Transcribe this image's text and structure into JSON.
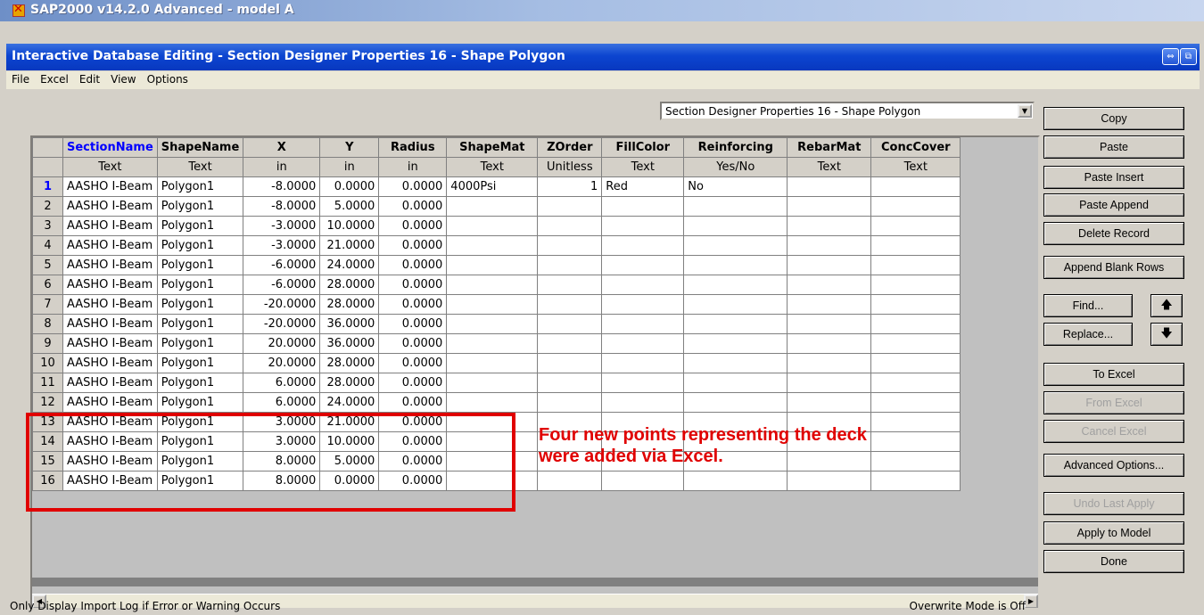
{
  "app": {
    "title": "SAP2000 v14.2.0 Advanced  - model A"
  },
  "window": {
    "title": "Interactive Database Editing - Section Designer Properties 16 - Shape Polygon",
    "restore_glyph": "⇔",
    "dock_glyph": "⧉"
  },
  "menu": [
    "File",
    "Excel",
    "Edit",
    "View",
    "Options"
  ],
  "table_selector": {
    "value": "Section Designer Properties 16 - Shape Polygon",
    "arrow": "▼"
  },
  "grid": {
    "columns": [
      "SectionName",
      "ShapeName",
      "X",
      "Y",
      "Radius",
      "ShapeMat",
      "ZOrder",
      "FillColor",
      "Reinforcing",
      "RebarMat",
      "ConcCover"
    ],
    "units": [
      "Text",
      "Text",
      "in",
      "in",
      "in",
      "Text",
      "Unitless",
      "Text",
      "Yes/No",
      "Text",
      "Text"
    ],
    "rows": [
      [
        "1",
        "AASHO I-Beam",
        "Polygon1",
        "-8.0000",
        "0.0000",
        "0.0000",
        "4000Psi",
        "1",
        "Red",
        "No",
        "",
        ""
      ],
      [
        "2",
        "AASHO I-Beam",
        "Polygon1",
        "-8.0000",
        "5.0000",
        "0.0000",
        "",
        "",
        "",
        "",
        "",
        ""
      ],
      [
        "3",
        "AASHO I-Beam",
        "Polygon1",
        "-3.0000",
        "10.0000",
        "0.0000",
        "",
        "",
        "",
        "",
        "",
        ""
      ],
      [
        "4",
        "AASHO I-Beam",
        "Polygon1",
        "-3.0000",
        "21.0000",
        "0.0000",
        "",
        "",
        "",
        "",
        "",
        ""
      ],
      [
        "5",
        "AASHO I-Beam",
        "Polygon1",
        "-6.0000",
        "24.0000",
        "0.0000",
        "",
        "",
        "",
        "",
        "",
        ""
      ],
      [
        "6",
        "AASHO I-Beam",
        "Polygon1",
        "-6.0000",
        "28.0000",
        "0.0000",
        "",
        "",
        "",
        "",
        "",
        ""
      ],
      [
        "7",
        "AASHO I-Beam",
        "Polygon1",
        "-20.0000",
        "28.0000",
        "0.0000",
        "",
        "",
        "",
        "",
        "",
        ""
      ],
      [
        "8",
        "AASHO I-Beam",
        "Polygon1",
        "-20.0000",
        "36.0000",
        "0.0000",
        "",
        "",
        "",
        "",
        "",
        ""
      ],
      [
        "9",
        "AASHO I-Beam",
        "Polygon1",
        "20.0000",
        "36.0000",
        "0.0000",
        "",
        "",
        "",
        "",
        "",
        ""
      ],
      [
        "10",
        "AASHO I-Beam",
        "Polygon1",
        "20.0000",
        "28.0000",
        "0.0000",
        "",
        "",
        "",
        "",
        "",
        ""
      ],
      [
        "11",
        "AASHO I-Beam",
        "Polygon1",
        "6.0000",
        "28.0000",
        "0.0000",
        "",
        "",
        "",
        "",
        "",
        ""
      ],
      [
        "12",
        "AASHO I-Beam",
        "Polygon1",
        "6.0000",
        "24.0000",
        "0.0000",
        "",
        "",
        "",
        "",
        "",
        ""
      ],
      [
        "13",
        "AASHO I-Beam",
        "Polygon1",
        "3.0000",
        "21.0000",
        "0.0000",
        "",
        "",
        "",
        "",
        "",
        ""
      ],
      [
        "14",
        "AASHO I-Beam",
        "Polygon1",
        "3.0000",
        "10.0000",
        "0.0000",
        "",
        "",
        "",
        "",
        "",
        ""
      ],
      [
        "15",
        "AASHO I-Beam",
        "Polygon1",
        "8.0000",
        "5.0000",
        "0.0000",
        "",
        "",
        "",
        "",
        "",
        ""
      ],
      [
        "16",
        "AASHO I-Beam",
        "Polygon1",
        "8.0000",
        "0.0000",
        "0.0000",
        "",
        "",
        "",
        "",
        "",
        ""
      ]
    ]
  },
  "annotation": {
    "line1": "Four new points representing the deck",
    "line2": "were added via Excel.",
    "color": "#e00000"
  },
  "buttons": {
    "copy": "Copy",
    "paste": "Paste",
    "paste_insert": "Paste Insert",
    "paste_append": "Paste Append",
    "delete_record": "Delete Record",
    "append_blank_rows": "Append Blank Rows",
    "find": "Find...",
    "replace": "Replace...",
    "up_arrow": "🡅",
    "down_arrow": "🡇",
    "to_excel": "To Excel",
    "from_excel": "From Excel",
    "cancel_excel": "Cancel Excel",
    "advanced_options": "Advanced Options...",
    "undo_last_apply": "Undo Last Apply",
    "apply_to_model": "Apply to Model",
    "done": "Done"
  },
  "scrollbar": {
    "left": "◀",
    "right": "▶"
  },
  "status": {
    "left": "Only Display Import Log if Error or Warning Occurs",
    "right": "Overwrite Mode is Off"
  }
}
